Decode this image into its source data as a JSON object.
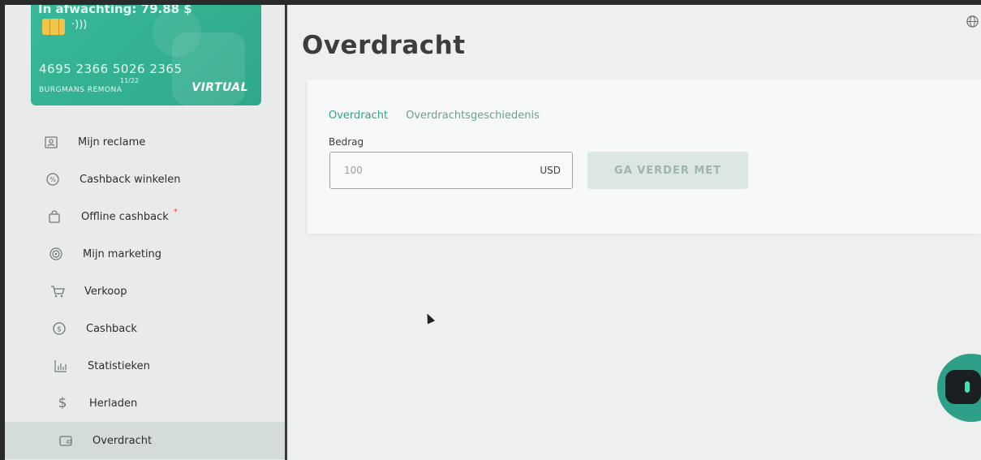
{
  "card": {
    "balance": "In afwachting: 79.88 $",
    "nfc": "·)))",
    "number": "4695 2366 5026 2365",
    "expiry": "11/22",
    "holder": "BURGMANS REMONA",
    "type": "VIRTUAL"
  },
  "sidebar": {
    "items": [
      {
        "label": "Mijn reclame",
        "icon": "id-card-icon"
      },
      {
        "label": "Cashback winkelen",
        "icon": "discount-badge-icon"
      },
      {
        "label": "Offline cashback",
        "icon": "shopping-bag-icon",
        "marker": "*"
      },
      {
        "label": "Mijn marketing",
        "icon": "marketing-swirl-icon"
      },
      {
        "label": "Verkoop",
        "icon": "cart-icon"
      },
      {
        "label": "Cashback",
        "icon": "dollar-circle-icon"
      },
      {
        "label": "Statistieken",
        "icon": "bar-chart-icon"
      },
      {
        "label": "Herladen",
        "icon": "dollar-icon"
      },
      {
        "label": "Overdracht",
        "icon": "wallet-icon",
        "active": true
      }
    ]
  },
  "main": {
    "title": "Overdracht",
    "tabs": [
      {
        "label": "Overdracht",
        "active": true
      },
      {
        "label": "Overdrachtsgeschiedenis",
        "active": false
      }
    ],
    "amount_label": "Bedrag",
    "amount_value": "100",
    "currency": "USD",
    "continue_label": "GA VERDER MET"
  },
  "colors": {
    "accent": "#2ea38a",
    "card": "#38b89a",
    "button_disabled_bg": "#dbe6e5"
  }
}
